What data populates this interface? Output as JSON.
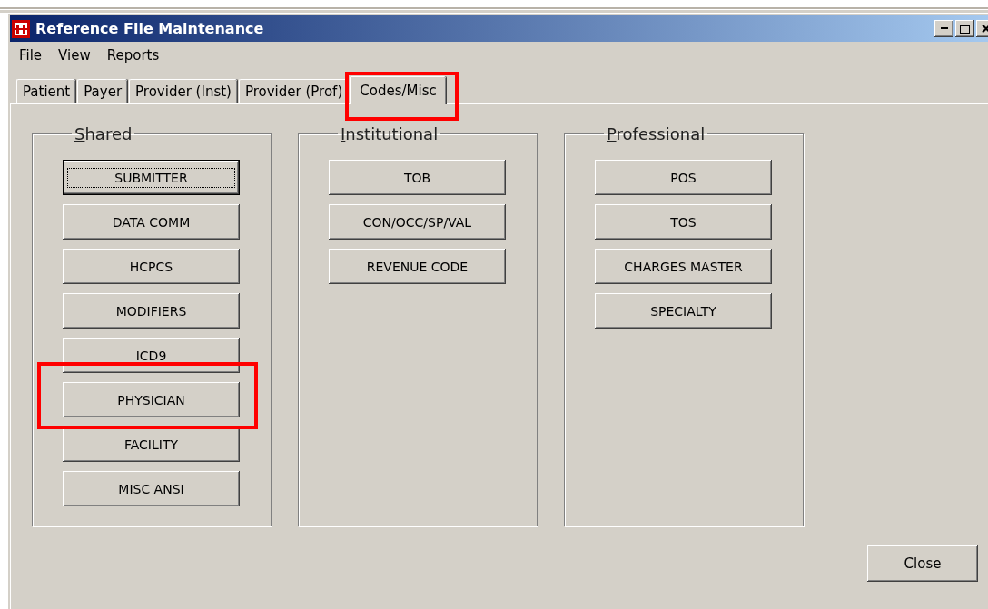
{
  "window": {
    "title": "Reference File Maintenance"
  },
  "menu": [
    "File",
    "View",
    "Reports"
  ],
  "tabs": [
    {
      "label": "Patient",
      "selected": false,
      "highlighted": false
    },
    {
      "label": "Payer",
      "selected": false,
      "highlighted": false
    },
    {
      "label": "Provider (Inst)",
      "selected": false,
      "highlighted": false
    },
    {
      "label": "Provider (Prof)",
      "selected": false,
      "highlighted": false
    },
    {
      "label": "Codes/Misc",
      "selected": true,
      "highlighted": true
    }
  ],
  "groups": [
    {
      "title": "Shared",
      "buttons": [
        {
          "label": "SUBMITTER",
          "focused": true,
          "highlighted": false
        },
        {
          "label": "DATA COMM",
          "focused": false,
          "highlighted": false
        },
        {
          "label": "HCPCS",
          "focused": false,
          "highlighted": false
        },
        {
          "label": "MODIFIERS",
          "focused": false,
          "highlighted": false
        },
        {
          "label": "ICD9",
          "focused": false,
          "highlighted": false
        },
        {
          "label": "PHYSICIAN",
          "focused": false,
          "highlighted": true
        },
        {
          "label": "FACILITY",
          "focused": false,
          "highlighted": false
        },
        {
          "label": "MISC ANSI",
          "focused": false,
          "highlighted": false
        }
      ]
    },
    {
      "title": "Institutional",
      "buttons": [
        {
          "label": "TOB",
          "focused": false,
          "highlighted": false
        },
        {
          "label": "CON/OCC/SP/VAL",
          "focused": false,
          "highlighted": false
        },
        {
          "label": "REVENUE CODE",
          "focused": false,
          "highlighted": false
        }
      ]
    },
    {
      "title": "Professional",
      "buttons": [
        {
          "label": "POS",
          "focused": false,
          "highlighted": false
        },
        {
          "label": "TOS",
          "focused": false,
          "highlighted": false
        },
        {
          "label": "CHARGES MASTER",
          "focused": false,
          "highlighted": false
        },
        {
          "label": "SPECIALTY",
          "focused": false,
          "highlighted": false
        }
      ]
    }
  ],
  "close_button": {
    "label": "Close"
  }
}
